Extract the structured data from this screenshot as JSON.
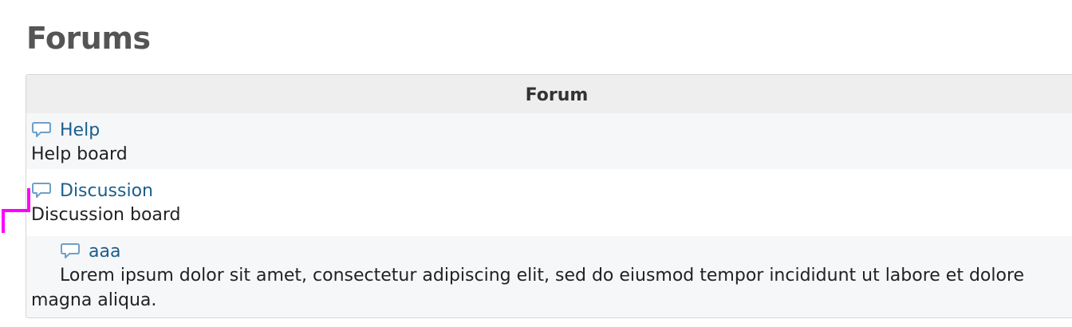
{
  "page": {
    "title": "Forums"
  },
  "table": {
    "header": "Forum",
    "rows": [
      {
        "title": "Help",
        "description": "Help board",
        "icon": "speech-bubble-icon"
      },
      {
        "title": "Discussion",
        "description": "Discussion board",
        "icon": "speech-bubble-icon"
      },
      {
        "title": "aaa",
        "description": "Lorem ipsum dolor sit amet, consectetur adipiscing elit, sed do eiusmod tempor incididunt ut labore et dolore magna aliqua.",
        "icon": "speech-bubble-icon"
      }
    ]
  },
  "colors": {
    "link": "#1b5e8c",
    "title": "#555555",
    "header_bg": "#eeeeee",
    "alt_row_bg": "#f6f7f9",
    "guide_mark": "#ff00ff"
  }
}
